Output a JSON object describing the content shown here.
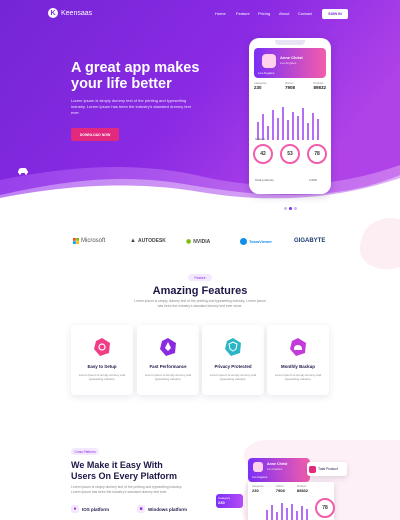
{
  "nav": {
    "logo_letter": "K",
    "logo_text": "Keensaas",
    "items": [
      "Home",
      "Feature",
      "Pricing",
      "About",
      "Contact"
    ],
    "signin": "SIGN IN"
  },
  "hero": {
    "title_line1": "A great app makes",
    "title_line2": "your life better",
    "desc": "Lorem Ipsum is simply dummy text of the printing and typesetting industry. Lorem Ipsum has been the industry's standard dummy text ever",
    "cta": "DOWNLOAD NOW"
  },
  "phone": {
    "name": "Anne Christ",
    "place": "Los Angeles",
    "tag": "Los Angeles",
    "stats": [
      {
        "label": "Categories",
        "value": "230"
      },
      {
        "label": "Visitors",
        "value": "7908"
      },
      {
        "label": "Products",
        "value": "89832"
      }
    ],
    "section": "Statistic",
    "circles": [
      "42",
      "53",
      "78"
    ],
    "footer": "Total products",
    "footer_value": "2,098"
  },
  "brands": [
    "Microsoft",
    "AUTODESK",
    "NVIDIA",
    "TeamViewer",
    "GIGABYTE"
  ],
  "features": {
    "pill": "Feature",
    "title": "Amazing Features",
    "subtitle": "Lorem Ipsum is simply dummy text of the printing and typesetting industry. Lorem Ipsum has been the industry's standard dummy text ever since.",
    "cards": [
      {
        "title": "Easy to Setup",
        "desc": "Lorem Ipsum is simply dummy and typesetting industry.",
        "icon": "settings-icon",
        "color": "#f03d85"
      },
      {
        "title": "Fast Performance",
        "desc": "Lorem Ipsum is simply dummy and typesetting industry.",
        "icon": "rocket-icon",
        "color": "#8a2be2"
      },
      {
        "title": "Privacy Protected",
        "desc": "Lorem Ipsum is simply dummy and typesetting industry.",
        "icon": "shield-icon",
        "color": "#2bb6c8"
      },
      {
        "title": "Monthly Backup",
        "desc": "Lorem Ipsum is simply dummy and typesetting industry.",
        "icon": "backup-icon",
        "color": "#c33bd8"
      }
    ]
  },
  "platform": {
    "pill": "Cross Platform",
    "title_line1": "We Make it Easy With",
    "title_line2": "Users On Every Platform",
    "desc": "Lorem Ipsum is simply dummy text of the printing and typesetting industry. Lorem Ipsum has been the industry's standard dummy text ever",
    "items": [
      "IOS platform",
      "Windows platform"
    ],
    "mock_name": "Anne Christ",
    "mock_place": "Los Angeles",
    "mock_tag": "Los Angeles",
    "mock_stats": [
      {
        "label": "Categories",
        "value": "230"
      },
      {
        "label": "Visitors",
        "value": "7908"
      },
      {
        "label": "Products",
        "value": "89832"
      }
    ],
    "total_label": "Total Product",
    "mini_label": "Category",
    "mini_value": "230",
    "circle": "78"
  },
  "colors": {
    "primary": "#7b2ff7",
    "accent": "#e2297e",
    "pink": "#f25dab"
  }
}
